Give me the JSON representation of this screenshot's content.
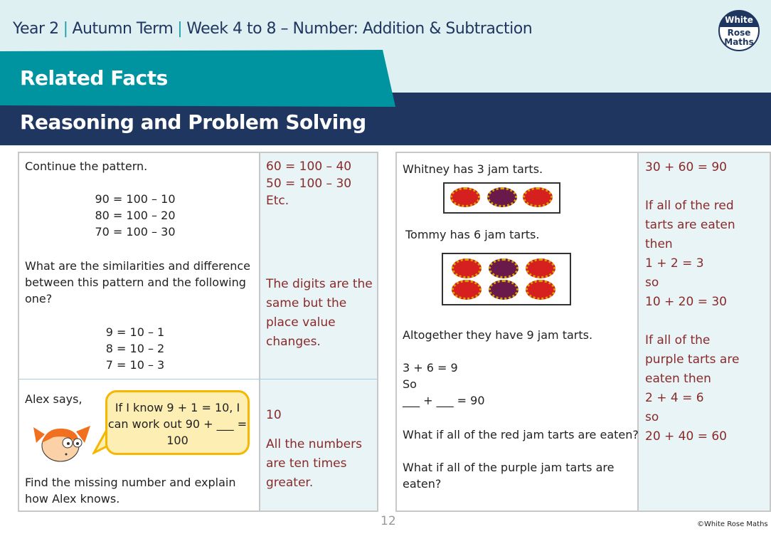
{
  "header": {
    "year": "Year 2",
    "term": "Autumn Term",
    "week": "Week 4 to 8 – Number: Addition & Subtraction",
    "logo": "White Rose Maths",
    "title": "Related Facts",
    "subtitle": "Reasoning and Problem Solving"
  },
  "left": {
    "q1": {
      "intro": "Continue the pattern.",
      "pattern1": [
        "90 = 100 – 10",
        "80 = 100 – 20",
        "70 = 100 – 30"
      ],
      "question": "What are the similarities and difference between this pattern and the following one?",
      "pattern2": [
        "9 = 10 – 1",
        "8 = 10 – 2",
        "7 = 10 – 3"
      ]
    },
    "a1": {
      "lines": [
        "60 = 100 – 40",
        "50 = 100 – 30",
        "Etc."
      ],
      "explain": "The digits are the same but the place value changes."
    },
    "q2": {
      "intro": "Alex says,",
      "speech": "If I know 9 + 1 = 10, I can work out 90 + ___ = 100",
      "question": "Find the missing number and explain how Alex knows."
    },
    "a2": {
      "answer": "10",
      "explain": "All the numbers are ten times greater."
    }
  },
  "right": {
    "q": {
      "l1": "Whitney has 3 jam tarts.",
      "l2": "Tommy has 6 jam tarts.",
      "l3": "Altogether they have 9 jam tarts.",
      "l4": "3 + 6 = 9",
      "l5": "So",
      "l6": "___ + ___ = 90",
      "l7": "What if all of the red jam tarts are eaten?",
      "l8": "What if all of the purple jam tarts are eaten?"
    },
    "a": {
      "lines": [
        "30 + 60 = 90",
        "If all of the red tarts are eaten then",
        "1 + 2 = 3",
        "so",
        "10 + 20 = 30",
        "If all of the purple tarts are eaten then",
        "2 + 4 = 6",
        "so",
        "20 + 40 = 60"
      ]
    }
  },
  "colors": {
    "red_tart": "#d62020",
    "purple_tart": "#6a1a4a"
  },
  "footer": {
    "page": "12",
    "copyright": "©White Rose Maths"
  }
}
